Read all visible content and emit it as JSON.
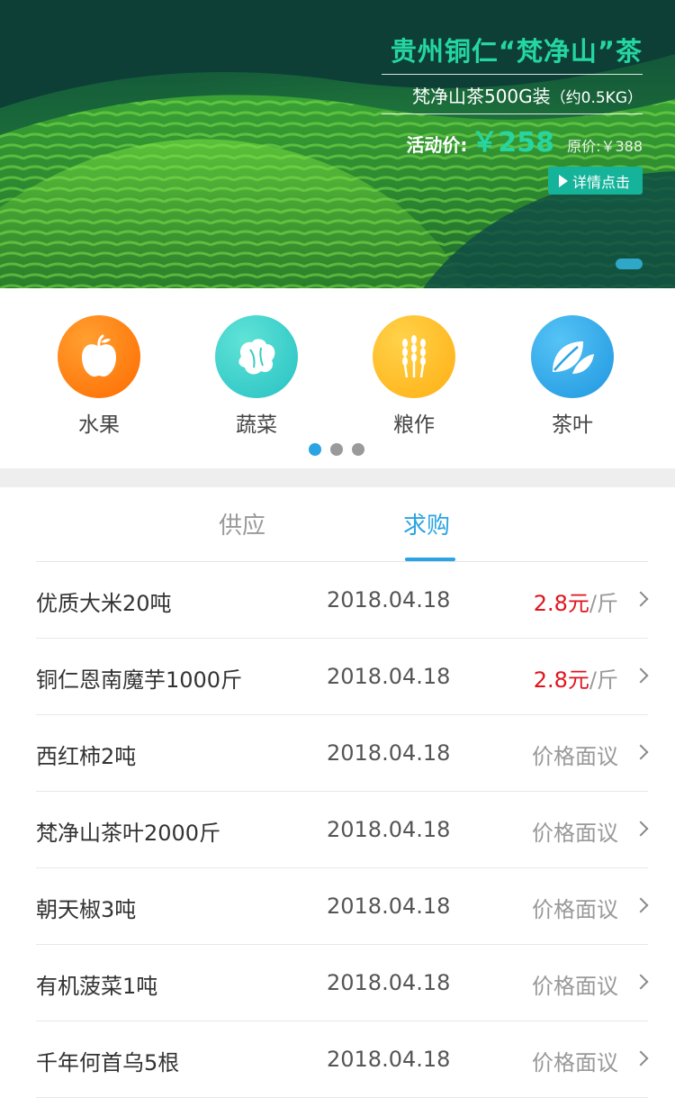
{
  "banner": {
    "title": "贵州铜仁“梵净山”茶",
    "subtitle": "梵净山茶500G装",
    "subtitle_unit": "（约0.5KG）",
    "price_label": "活动价:",
    "price_value": "￥258",
    "original_price": "原价:￥388",
    "detail_button": "详情点击"
  },
  "categories": [
    {
      "label": "水果",
      "icon": "apple-icon",
      "color": "#ff7a14"
    },
    {
      "label": "蔬菜",
      "icon": "cabbage-icon",
      "color": "#35cfc7"
    },
    {
      "label": "粮作",
      "icon": "wheat-icon",
      "color": "#ffb61e"
    },
    {
      "label": "茶叶",
      "icon": "tea-leaf-icon",
      "color": "#2ba3e6"
    }
  ],
  "tabs": {
    "supply": "供应",
    "demand": "求购",
    "active": "demand"
  },
  "list": [
    {
      "name": "优质大米20吨",
      "date": "2018.04.18",
      "price": "2.8元",
      "unit": "/斤",
      "negotiable": false
    },
    {
      "name": "铜仁恩南魔芋1000斤",
      "date": "2018.04.18",
      "price": "2.8元",
      "unit": "/斤",
      "negotiable": false
    },
    {
      "name": "西红柿2吨",
      "date": "2018.04.18",
      "price": "价格面议",
      "unit": "",
      "negotiable": true
    },
    {
      "name": "梵净山茶叶2000斤",
      "date": "2018.04.18",
      "price": "价格面议",
      "unit": "",
      "negotiable": true
    },
    {
      "name": "朝天椒3吨",
      "date": "2018.04.18",
      "price": "价格面议",
      "unit": "",
      "negotiable": true
    },
    {
      "name": "有机菠菜1吨",
      "date": "2018.04.18",
      "price": "价格面议",
      "unit": "",
      "negotiable": true
    },
    {
      "name": "千年何首乌5根",
      "date": "2018.04.18",
      "price": "价格面议",
      "unit": "",
      "negotiable": true
    }
  ]
}
